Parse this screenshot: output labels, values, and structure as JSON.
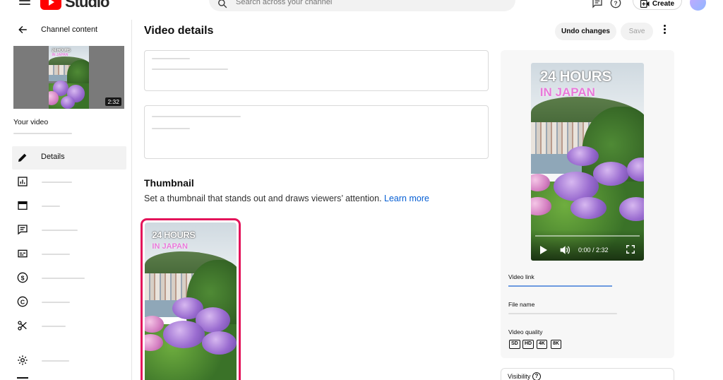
{
  "app": {
    "logo_text": "Studio"
  },
  "search": {
    "placeholder": "Search across your channel"
  },
  "header": {
    "create_label": "Create"
  },
  "sidebar": {
    "back_label": "Channel content",
    "thumbnail_duration": "2:32",
    "your_video_label": "Your video",
    "items": [
      {
        "label": "Details",
        "icon": "pencil-icon",
        "active": true
      },
      {
        "label": "",
        "icon": "analytics-icon"
      },
      {
        "label": "",
        "icon": "editor-icon"
      },
      {
        "label": "",
        "icon": "comments-icon"
      },
      {
        "label": "",
        "icon": "subtitles-icon"
      },
      {
        "label": "",
        "icon": "monetization-icon"
      },
      {
        "label": "",
        "icon": "copyright-icon"
      },
      {
        "label": "",
        "icon": "clips-icon"
      },
      {
        "label": "",
        "icon": "settings-icon"
      }
    ]
  },
  "main": {
    "title": "Video details",
    "undo_label": "Undo changes",
    "save_label": "Save",
    "thumbnail": {
      "title": "Thumbnail",
      "description": "Set a thumbnail that stands out and draws viewers’ attention.",
      "learn_more": "Learn more"
    }
  },
  "video": {
    "overlay_line1": "24 HOURS",
    "overlay_line2": "IN JAPAN",
    "time": "0:00 / 2:32"
  },
  "preview": {
    "video_link_label": "Video link",
    "file_name_label": "File name",
    "video_quality_label": "Video quality",
    "qualities": [
      "SD",
      "HD",
      "4K",
      "8K"
    ],
    "visibility_label": "Visibility",
    "help_glyph": "?"
  },
  "colors": {
    "accent_link": "#065fd4",
    "thumbnail_selected_border": "#e3145a",
    "brand_red": "#ff0000"
  }
}
